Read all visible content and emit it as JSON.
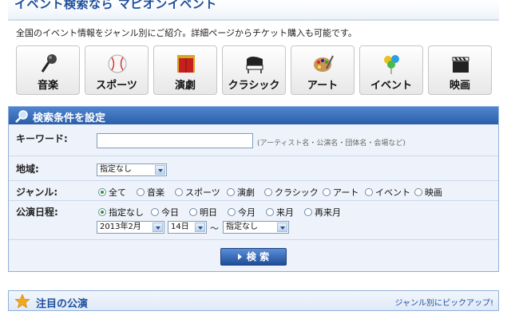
{
  "header": {
    "title": "イベント検索なら マピオンイベント"
  },
  "intro": "全国のイベント情報をジャンル別にご紹介。詳細ページからチケット購入も可能です。",
  "genres": [
    {
      "label": "音楽",
      "icon": "microphone-icon"
    },
    {
      "label": "スポーツ",
      "icon": "baseball-icon"
    },
    {
      "label": "演劇",
      "icon": "theater-curtain-icon"
    },
    {
      "label": "クラシック",
      "icon": "piano-icon"
    },
    {
      "label": "アート",
      "icon": "palette-icon"
    },
    {
      "label": "イベント",
      "icon": "balloons-icon"
    },
    {
      "label": "映画",
      "icon": "clapperboard-icon"
    }
  ],
  "search_panel": {
    "title": "検索条件を設定",
    "keyword_label": "キーワード:",
    "keyword_value": "",
    "keyword_hint": "(アーティスト名・公演名・団体名・会場など)",
    "region_label": "地域:",
    "region_value": "指定なし",
    "genre_label": "ジャンル:",
    "genre_options": [
      "全て",
      "音楽",
      "スポーツ",
      "演劇",
      "クラシック",
      "アート",
      "イベント",
      "映画"
    ],
    "genre_selected": "全て",
    "date_label": "公演日程:",
    "date_options": [
      "指定なし",
      "今日",
      "明日",
      "今月",
      "来月",
      "再来月"
    ],
    "date_selected": "指定なし",
    "month_value": "2013年2月",
    "day_value": "14日",
    "tilde": "〜",
    "end_value": "指定なし",
    "button_label": "検 索"
  },
  "featured": {
    "title": "注目の公演",
    "pickup_link": "ジャンル別にピックアップ!"
  },
  "colors": {
    "accent": "#2c5ea8",
    "title": "#1d4f9c",
    "panel_bg": "#eef3fb"
  }
}
